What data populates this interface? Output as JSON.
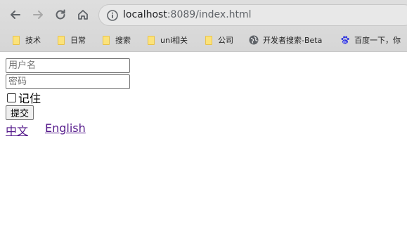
{
  "browser": {
    "url_host": "localhost",
    "url_rest": ":8089/index.html",
    "bookmarks": [
      {
        "label": "技术",
        "icon": "folder-icon"
      },
      {
        "label": "日常",
        "icon": "folder-icon"
      },
      {
        "label": "搜索",
        "icon": "folder-icon"
      },
      {
        "label": "uni相关",
        "icon": "folder-icon"
      },
      {
        "label": "公司",
        "icon": "folder-icon"
      },
      {
        "label": "开发者搜索-Beta",
        "icon": "globe-icon"
      },
      {
        "label": "百度一下，你",
        "icon": "baidu-paw-icon"
      }
    ]
  },
  "form": {
    "username_placeholder": "用户名",
    "password_placeholder": "密码",
    "remember_label": "记住",
    "remember_checked": false,
    "submit_label": "提交"
  },
  "languages": {
    "chinese_label": "中文",
    "english_label": "English"
  },
  "colors": {
    "link_visited": "#551a8b",
    "toolbar_bg": "#dedede"
  }
}
